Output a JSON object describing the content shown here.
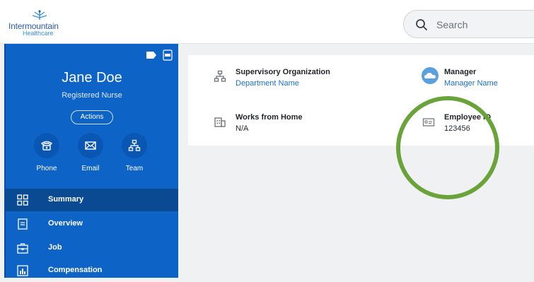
{
  "brand": {
    "line1": "Intermountain",
    "line2": "Healthcare"
  },
  "search": {
    "placeholder": "Search"
  },
  "profile": {
    "name": "Jane Doe",
    "role": "Registered Nurse",
    "actions_label": "Actions"
  },
  "quick_actions": [
    {
      "label": "Phone",
      "icon": "phone-icon"
    },
    {
      "label": "Email",
      "icon": "email-icon"
    },
    {
      "label": "Team",
      "icon": "team-icon"
    }
  ],
  "nav": [
    {
      "label": "Summary",
      "icon": "summary-grid-icon",
      "active": true
    },
    {
      "label": "Overview",
      "icon": "overview-document-icon",
      "active": false
    },
    {
      "label": "Job",
      "icon": "job-briefcase-icon",
      "active": false
    },
    {
      "label": "Compensation",
      "icon": "compensation-chart-icon",
      "active": false
    }
  ],
  "fields": {
    "supervisory_org": {
      "label": "Supervisory Organization",
      "value": "Department Name"
    },
    "manager": {
      "label": "Manager",
      "value": "Manager Name"
    },
    "works_from_home": {
      "label": "Works from Home",
      "value": "N/A"
    },
    "employee_id": {
      "label": "Employee ID",
      "value": "123456"
    }
  },
  "colors": {
    "sidebar": "#0e63c7",
    "sidebar_active": "#0a4a93",
    "link": "#1b6fc9",
    "highlight_ring": "#6aa33a"
  }
}
